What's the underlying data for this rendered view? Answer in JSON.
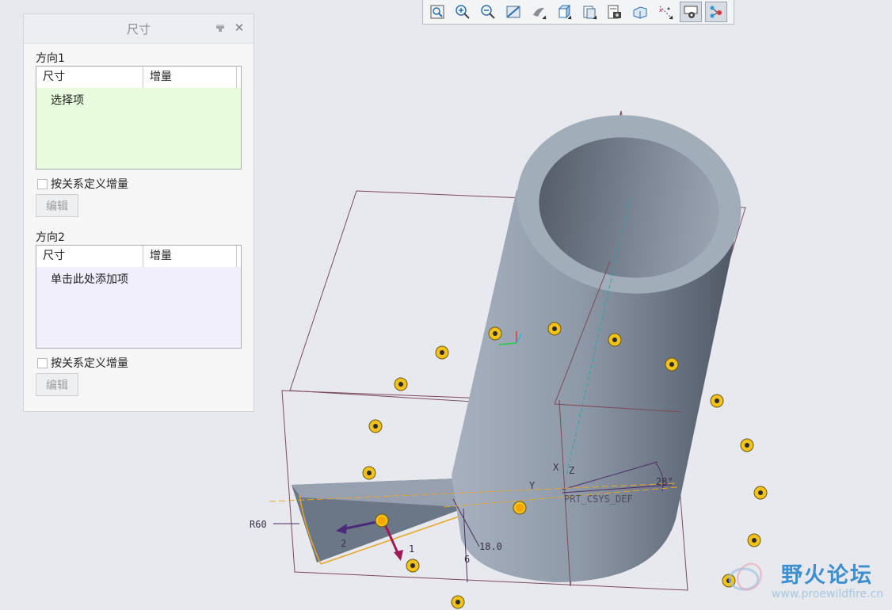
{
  "toolbar": {
    "buttons": [
      {
        "icon": "refit-icon"
      },
      {
        "icon": "zoom-in-icon"
      },
      {
        "icon": "zoom-out-icon"
      },
      {
        "icon": "repaint-icon"
      },
      {
        "icon": "display-style-icon"
      },
      {
        "icon": "saved-orientations-icon"
      },
      {
        "icon": "view-manager-icon"
      },
      {
        "icon": "appearance-gallery-icon"
      },
      {
        "icon": "perspective-view-icon"
      },
      {
        "icon": "datum-display-icon"
      },
      {
        "icon": "annotation-display-icon"
      },
      {
        "icon": "spin-center-icon"
      }
    ]
  },
  "panel": {
    "title": "尺寸",
    "direction1": {
      "label": "方向1",
      "col_dimension": "尺寸",
      "col_increment": "增量",
      "placeholder": "选择项",
      "relation_checkbox": "按关系定义增量",
      "edit_button": "编辑"
    },
    "direction2": {
      "label": "方向2",
      "col_dimension": "尺寸",
      "col_increment": "增量",
      "placeholder": "单击此处添加项",
      "relation_checkbox": "按关系定义增量",
      "edit_button": "编辑"
    }
  },
  "model": {
    "dimensions": {
      "radius": "R60",
      "length": "18.0",
      "angle": "28°",
      "small": "6"
    },
    "axis_labels": {
      "x": "X",
      "y": "Y",
      "z": "Z",
      "csys": "PRT_CSYS_DEF"
    },
    "drag_labels": {
      "first": "1",
      "second": "2"
    }
  },
  "watermark": {
    "title": "野火论坛",
    "url": "www.proewildfire.cn"
  }
}
